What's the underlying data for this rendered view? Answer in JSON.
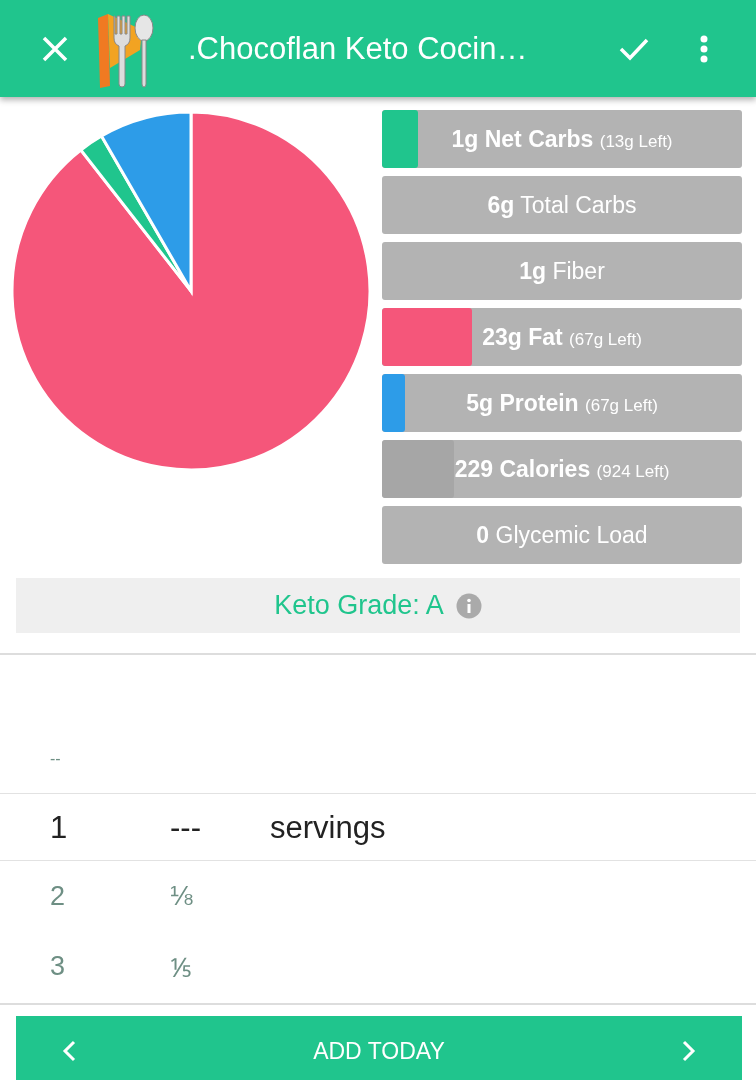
{
  "app_bar": {
    "title": ".Chocoflan Keto Cocin…"
  },
  "macros": [
    {
      "text": "**1g Net Carbs**",
      "remaining": "(13g Left)",
      "level": 0.1,
      "color": "#20c58d"
    },
    {
      "text": "**6g** Total Carbs"
    },
    {
      "text": "**1g** Fiber"
    },
    {
      "text": "**23g Fat**",
      "remaining": "(67g Left)",
      "level": 0.25,
      "color": "#f5567a"
    },
    {
      "text": "**5g Protein**",
      "remaining": "(67g Left)",
      "level": 0.065,
      "color": "#2d9ce8"
    },
    {
      "text": "**229 Calories**",
      "remaining": "(924 Left)",
      "level": 0.2,
      "color": "#a6a6a6"
    },
    {
      "text": "**0** Glycemic Load"
    }
  ],
  "keto_grade": {
    "text": "Keto Grade: A"
  },
  "picker": {
    "columns": [
      {
        "items": [
          {
            "text": "--",
            "selected": false
          },
          {
            "text": "1",
            "selected": true
          },
          {
            "text": "2",
            "selected": false
          },
          {
            "text": "3",
            "selected": false
          }
        ]
      },
      {
        "items": [
          {
            "text": "---",
            "selected": true
          },
          {
            "text": "⅛",
            "selected": false
          },
          {
            "text": "⅕",
            "selected": false
          }
        ]
      },
      {
        "items": [
          {
            "text": "servings",
            "selected": true
          }
        ]
      }
    ]
  },
  "add_button": {
    "label": "ADD TODAY"
  }
}
